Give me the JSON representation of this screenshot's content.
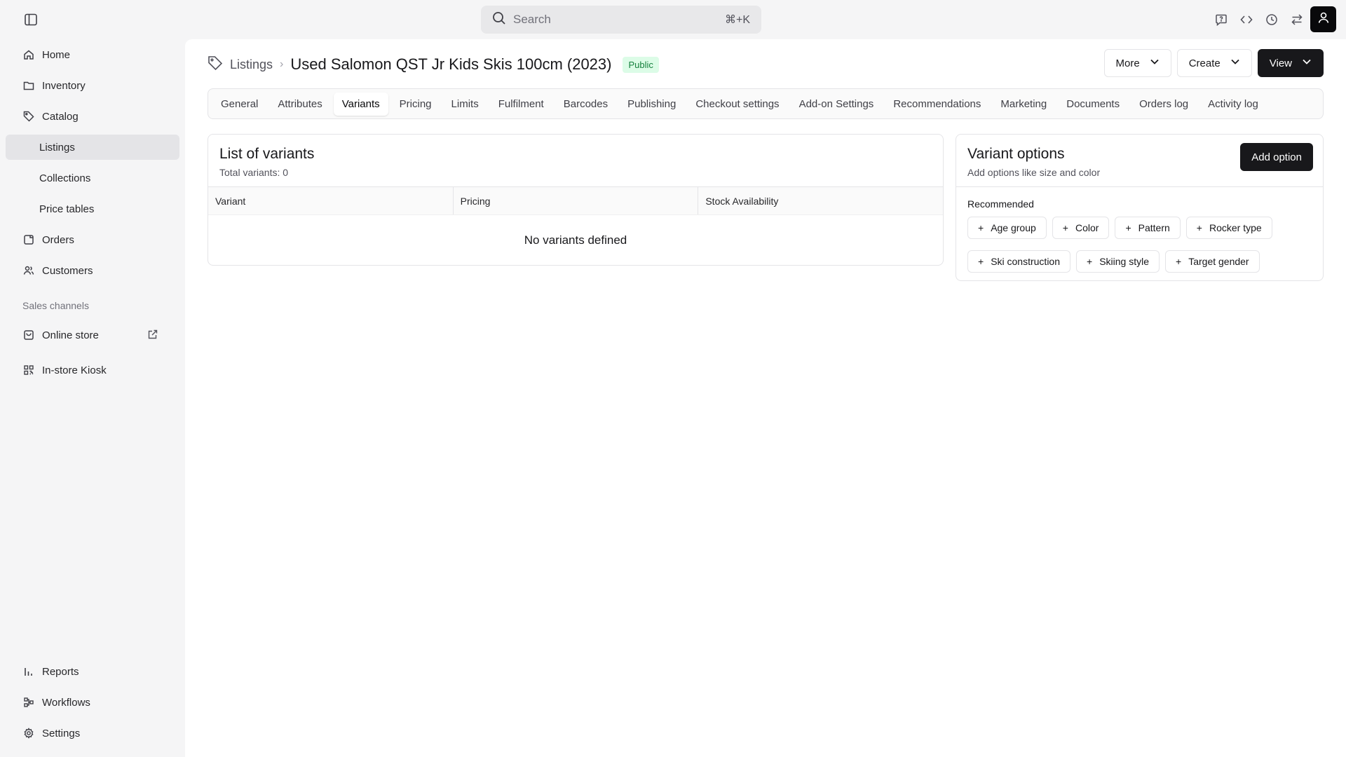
{
  "search": {
    "placeholder": "Search",
    "shortcut": "⌘+K"
  },
  "sidebar": {
    "items": [
      {
        "label": "Home",
        "icon": "home-icon"
      },
      {
        "label": "Inventory",
        "icon": "folder-icon"
      },
      {
        "label": "Catalog",
        "icon": "tag-icon"
      },
      {
        "label": "Listings"
      },
      {
        "label": "Collections"
      },
      {
        "label": "Price tables"
      },
      {
        "label": "Orders",
        "icon": "orders-icon"
      },
      {
        "label": "Customers",
        "icon": "users-icon"
      }
    ],
    "sales_channels_label": "Sales channels",
    "channels": [
      {
        "label": "Online store",
        "icon": "store-icon"
      },
      {
        "label": "In-store Kiosk",
        "icon": "qr-icon"
      }
    ],
    "bottom": [
      {
        "label": "Reports",
        "icon": "chart-icon"
      },
      {
        "label": "Workflows",
        "icon": "workflow-icon"
      },
      {
        "label": "Settings",
        "icon": "gear-icon"
      }
    ]
  },
  "header": {
    "breadcrumb_parent": "Listings",
    "title": "Used Salomon QST Jr Kids Skis 100cm (2023)",
    "status": "Public",
    "actions": {
      "more": "More",
      "create": "Create",
      "view": "View"
    }
  },
  "tabs": [
    "General",
    "Attributes",
    "Variants",
    "Pricing",
    "Limits",
    "Fulfilment",
    "Barcodes",
    "Publishing",
    "Checkout settings",
    "Add-on Settings",
    "Recommendations",
    "Marketing",
    "Documents",
    "Orders log",
    "Activity log"
  ],
  "active_tab": "Variants",
  "variants": {
    "title": "List of variants",
    "total": "Total variants: 0",
    "columns": [
      "Variant",
      "Pricing",
      "Stock Availability"
    ],
    "empty": "No variants defined"
  },
  "options": {
    "title": "Variant options",
    "subtitle": "Add options like size and color",
    "add_button": "Add option",
    "recommended_label": "Recommended",
    "recommended": [
      "Age group",
      "Color",
      "Pattern",
      "Rocker type",
      "Ski construction",
      "Skiing style",
      "Target gender"
    ]
  },
  "colors": {
    "accent": "#18181b",
    "badge_bg": "#dcfce7",
    "badge_text": "#15803d"
  }
}
